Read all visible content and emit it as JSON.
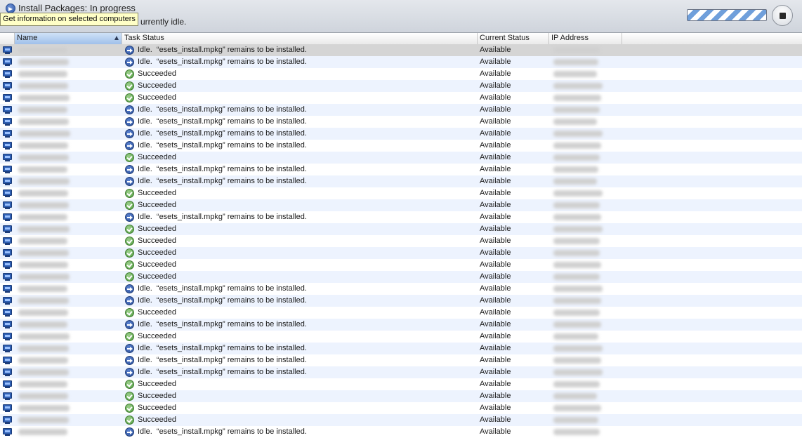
{
  "task": {
    "title": "Install Packages: In progress",
    "subtitle": "urrently idle.",
    "tooltip": "Get information on selected computers"
  },
  "columns": {
    "name": "Name",
    "task_status": "Task Status",
    "current_status": "Current Status",
    "ip_address": "IP Address"
  },
  "status_labels": {
    "idle": "Idle.  “esets_install.mpkg” remains to be installed.",
    "ok": "Succeeded",
    "available": "Available"
  },
  "icons": {
    "task": "arrow-circle-icon",
    "stop": "stop-icon",
    "computer": "computer-icon",
    "idle": "idle-arrow-icon",
    "succeeded": "checkmark-icon"
  },
  "rows": [
    {
      "status": "idle",
      "current": "Available"
    },
    {
      "status": "idle",
      "current": "Available"
    },
    {
      "status": "ok",
      "current": "Available"
    },
    {
      "status": "ok",
      "current": "Available"
    },
    {
      "status": "ok",
      "current": "Available"
    },
    {
      "status": "idle",
      "current": "Available"
    },
    {
      "status": "idle",
      "current": "Available"
    },
    {
      "status": "idle",
      "current": "Available"
    },
    {
      "status": "idle",
      "current": "Available"
    },
    {
      "status": "ok",
      "current": "Available"
    },
    {
      "status": "idle",
      "current": "Available"
    },
    {
      "status": "idle",
      "current": "Available"
    },
    {
      "status": "ok",
      "current": "Available"
    },
    {
      "status": "ok",
      "current": "Available"
    },
    {
      "status": "idle",
      "current": "Available"
    },
    {
      "status": "ok",
      "current": "Available"
    },
    {
      "status": "ok",
      "current": "Available"
    },
    {
      "status": "ok",
      "current": "Available"
    },
    {
      "status": "ok",
      "current": "Available"
    },
    {
      "status": "ok",
      "current": "Available"
    },
    {
      "status": "idle",
      "current": "Available"
    },
    {
      "status": "idle",
      "current": "Available"
    },
    {
      "status": "ok",
      "current": "Available"
    },
    {
      "status": "idle",
      "current": "Available"
    },
    {
      "status": "ok",
      "current": "Available"
    },
    {
      "status": "idle",
      "current": "Available"
    },
    {
      "status": "idle",
      "current": "Available"
    },
    {
      "status": "idle",
      "current": "Available"
    },
    {
      "status": "ok",
      "current": "Available"
    },
    {
      "status": "ok",
      "current": "Available"
    },
    {
      "status": "ok",
      "current": "Available"
    },
    {
      "status": "ok",
      "current": "Available"
    },
    {
      "status": "idle",
      "current": "Available"
    }
  ]
}
